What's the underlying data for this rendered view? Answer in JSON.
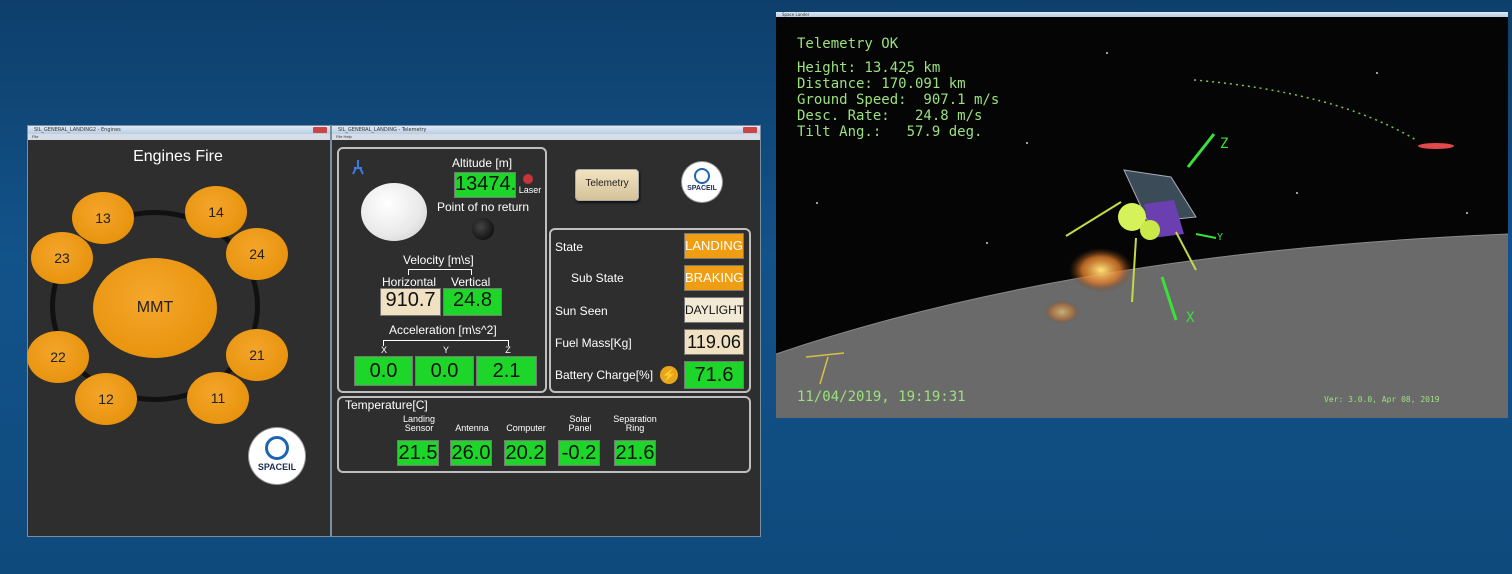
{
  "engines_window": {
    "title_bar": "SIL_GENERAL_LANDING2 - Engines",
    "menu": "File",
    "title": "Engines Fire",
    "main_engine": "MMT",
    "engines": [
      "13",
      "14",
      "23",
      "24",
      "22",
      "21",
      "12",
      "11"
    ],
    "logo": "SPACEIL"
  },
  "telemetry_window": {
    "title_bar": "SIL_GENERAL_LANDING - Telemetry",
    "menu": "File  Help",
    "altitude_label": "Altitude [m]",
    "altitude_value": "13474.",
    "laser_label": "Laser",
    "ponr_label": "Point of no return",
    "velocity_label": "Velocity [m\\s]",
    "horizontal_label": "Horizontal",
    "vertical_label": "Vertical",
    "horizontal_value": "910.7",
    "vertical_value": "24.8",
    "acceleration_label": "Acceleration [m\\s^2]",
    "axes": [
      "X",
      "Y",
      "Z"
    ],
    "acceleration_values": [
      "0.0",
      "0.0",
      "2.1"
    ],
    "telemetry_button": "Telemetry",
    "logo": "SPACEIL",
    "state_label": "State",
    "state_value": "LANDING",
    "substate_label": "Sub State",
    "substate_value": "BRAKING",
    "sun_label": "Sun Seen",
    "sun_value": "DAYLIGHT",
    "fuel_label": "Fuel Mass[Kg]",
    "fuel_value": "119.06",
    "battery_label": "Battery Charge[%]",
    "battery_value": "71.6",
    "temperature_title": "Temperature[C]",
    "temps": [
      {
        "label_1": "Landing",
        "label_2": "Sensor",
        "value": "21.5"
      },
      {
        "label_1": "",
        "label_2": "Antenna",
        "value": "26.0"
      },
      {
        "label_1": "",
        "label_2": "Computer",
        "value": "20.2"
      },
      {
        "label_1": "Solar",
        "label_2": "Panel",
        "value": "-0.2"
      },
      {
        "label_1": "Separation",
        "label_2": "Ring",
        "value": "21.6"
      }
    ]
  },
  "simulation": {
    "title_bar": "Space Lander",
    "status": "Telemetry OK",
    "height": "Height: 13.425 km",
    "distance": "Distance: 170.091 km",
    "ground_speed": "Ground Speed:  907.1 m/s",
    "desc_rate": "Desc. Rate:   24.8 m/s",
    "tilt": "Tilt Ang.:   57.9 deg.",
    "timestamp": "11/04/2019, 19:19:31",
    "version": "Ver: 3.0.0, Apr 08, 2019",
    "axis_z": "Z",
    "axis_y": "Y",
    "axis_x": "X"
  }
}
